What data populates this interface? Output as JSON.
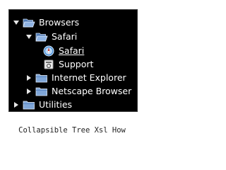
{
  "tree": {
    "items": [
      {
        "label": "Browsers",
        "icon": "folder-open-icon",
        "toggle": "expanded"
      },
      {
        "label": "Safari",
        "icon": "folder-open-icon",
        "toggle": "expanded"
      },
      {
        "label": "Safari",
        "icon": "safari-compass-icon",
        "toggle": "none",
        "selected": true
      },
      {
        "label": "Support",
        "icon": "support-doc-icon",
        "toggle": "none"
      },
      {
        "label": "Internet Explorer",
        "icon": "folder-closed-icon",
        "toggle": "collapsed"
      },
      {
        "label": "Netscape Browser",
        "icon": "folder-closed-icon",
        "toggle": "collapsed"
      },
      {
        "label": "Utilities",
        "icon": "folder-closed-icon",
        "toggle": "collapsed"
      }
    ]
  },
  "caption": "Collapsible Tree Xsl How",
  "colors": {
    "panel_background": "#000000",
    "text": "#ffffff",
    "folder_blue": "#7fa6d8"
  }
}
